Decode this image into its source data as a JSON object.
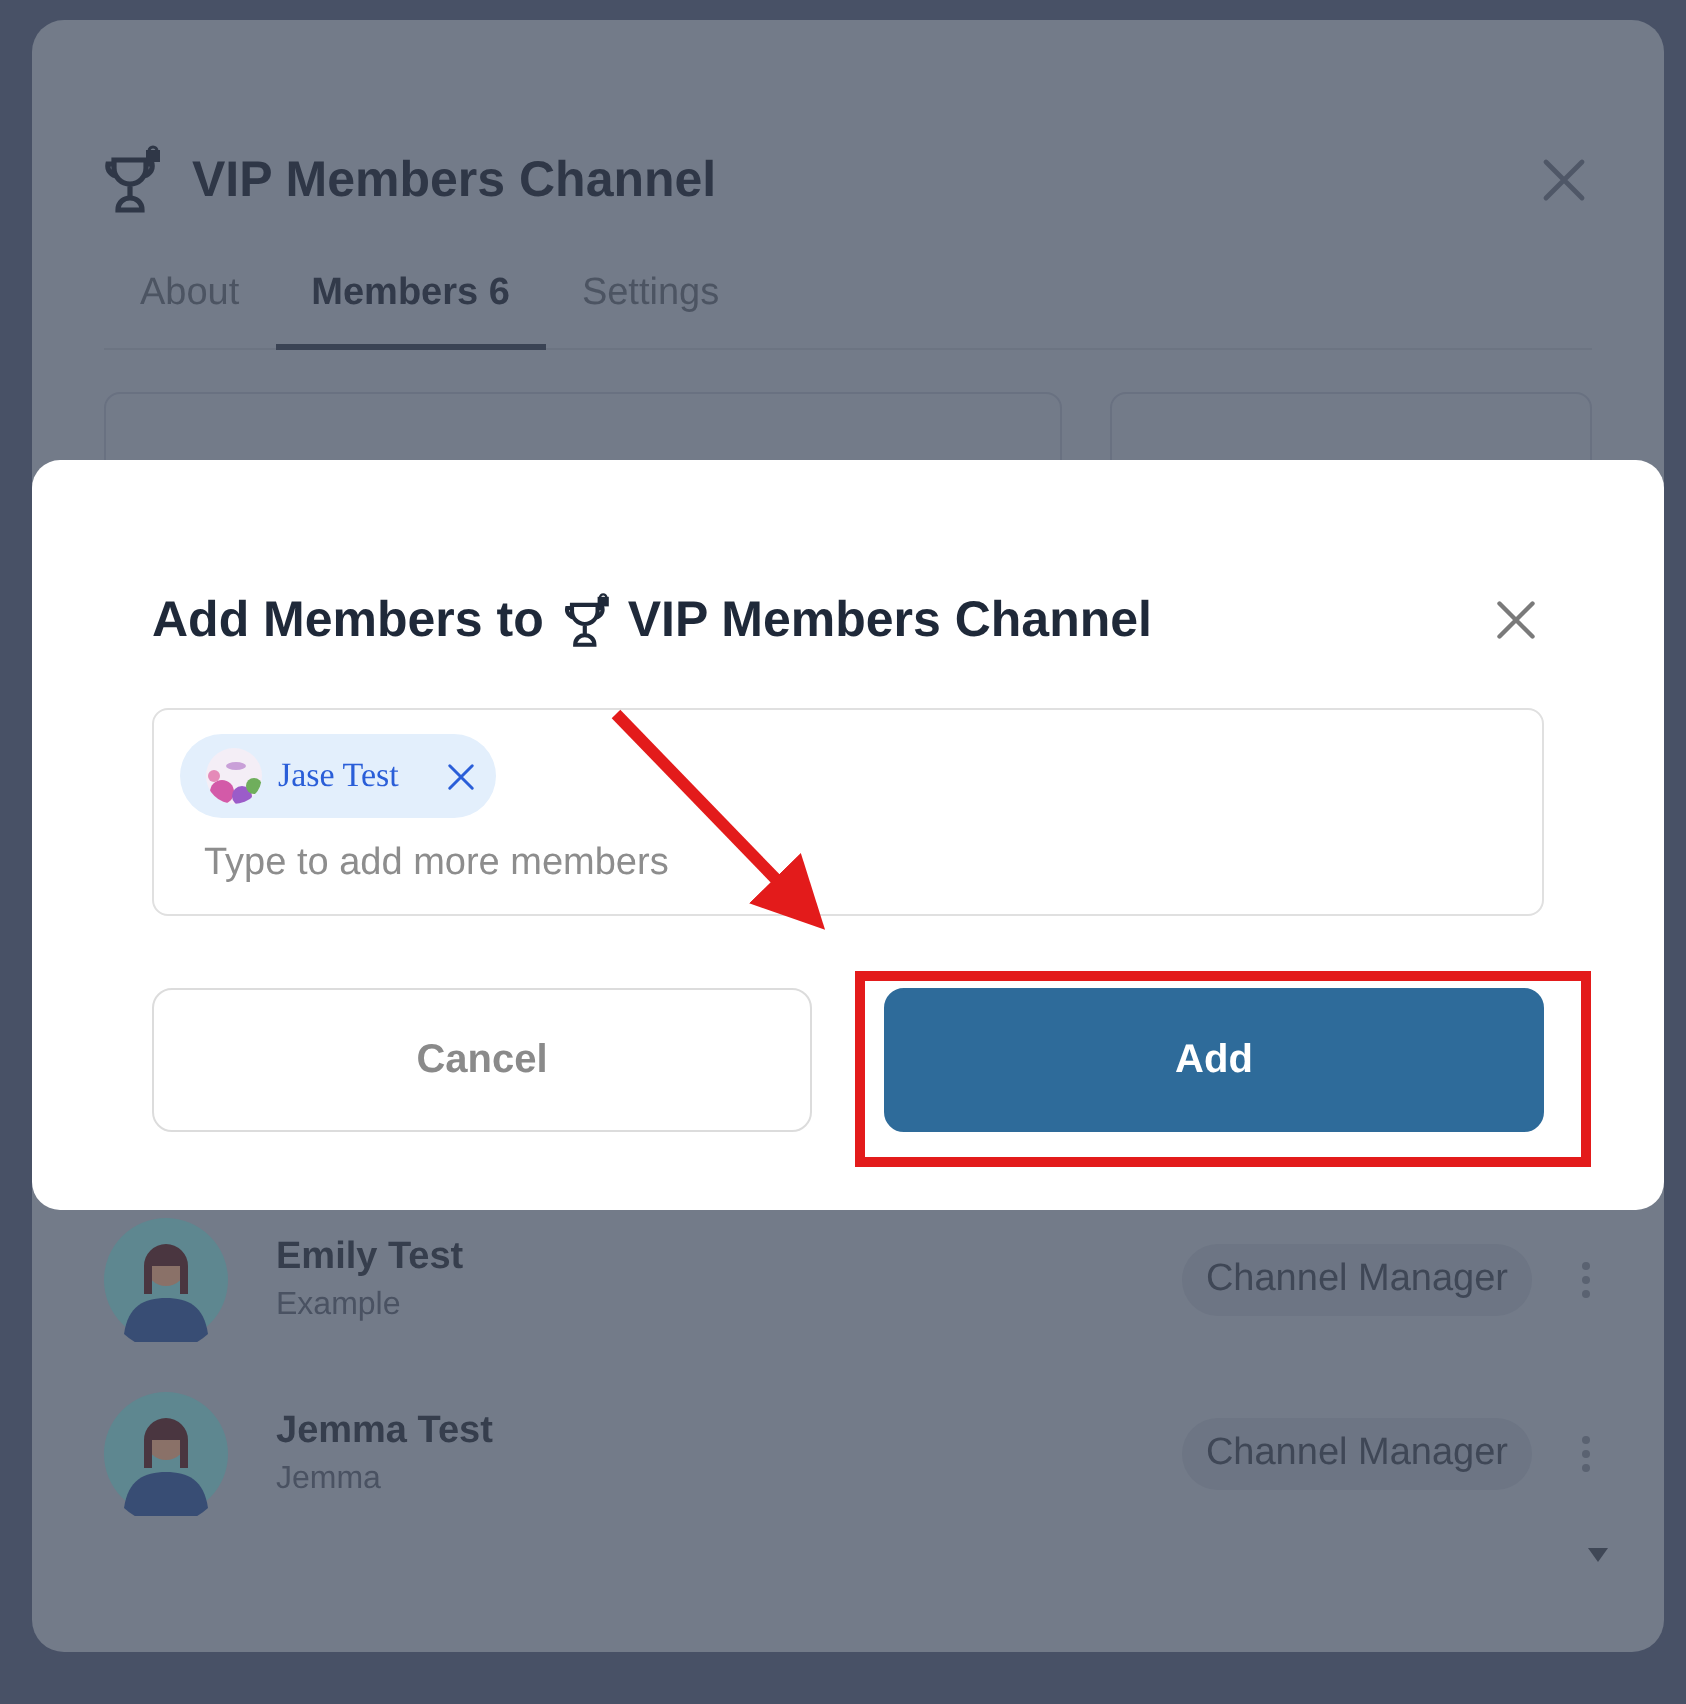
{
  "back_dialog": {
    "title": "VIP Members Channel",
    "tabs": [
      {
        "label": "About",
        "selected": false
      },
      {
        "label": "Members 6",
        "selected": true
      },
      {
        "label": "Settings",
        "selected": false
      }
    ],
    "members": [
      {
        "name": "Emily Test",
        "subtitle": "Example",
        "role": "Channel Manager"
      },
      {
        "name": "Jemma Test",
        "subtitle": "Jemma",
        "role": "Channel Manager"
      }
    ]
  },
  "add_dialog": {
    "title": "Add Members to",
    "channel_name": "VIP Members Channel",
    "chips": [
      {
        "name": "Jase Test"
      }
    ],
    "placeholder": "Type to add more members",
    "buttons": [
      {
        "label": "Cancel",
        "kind": "secondary"
      },
      {
        "label": "Add",
        "kind": "primary"
      }
    ]
  }
}
